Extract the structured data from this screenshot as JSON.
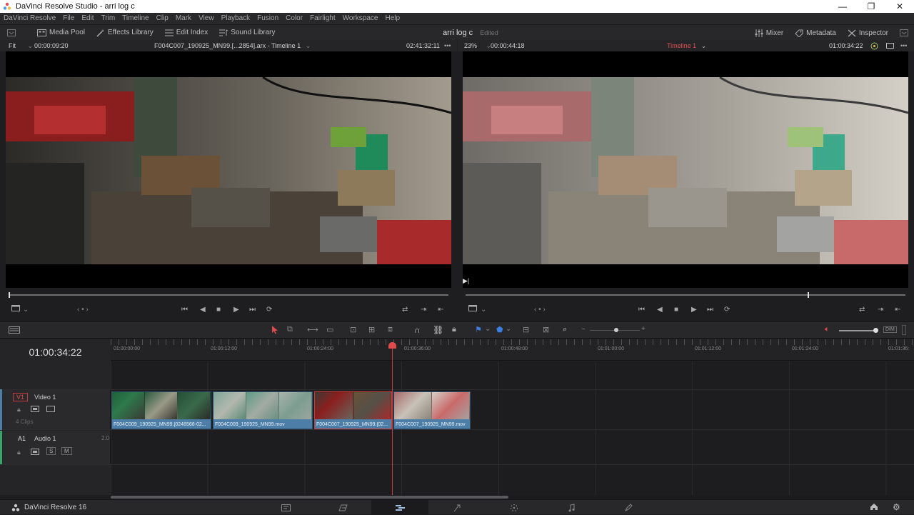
{
  "window": {
    "title": "DaVinci Resolve Studio - arri log c",
    "minimize": "—",
    "maximize": "❐",
    "close": "✕"
  },
  "menu": [
    "DaVinci Resolve",
    "File",
    "Edit",
    "Trim",
    "Timeline",
    "Clip",
    "Mark",
    "View",
    "Playback",
    "Fusion",
    "Color",
    "Fairlight",
    "Workspace",
    "Help"
  ],
  "toolbar": {
    "media_pool": "Media Pool",
    "effects_library": "Effects Library",
    "edit_index": "Edit Index",
    "sound_library": "Sound Library",
    "project_name": "arri log c",
    "project_status": "Edited",
    "mixer": "Mixer",
    "metadata": "Metadata",
    "inspector": "Inspector"
  },
  "source_viewer": {
    "zoom": "Fit",
    "duration": "00:00:09:20",
    "clip_name": "F004C007_190925_MN99.[...2854].arx - Timeline 1",
    "timecode": "02:41:32:11"
  },
  "timeline_viewer": {
    "zoom": "23%",
    "duration": "00:00:44:18",
    "timeline_name": "Timeline 1",
    "timecode": "01:00:34:22"
  },
  "timeline": {
    "current_timecode": "01:00:34:22",
    "ruler_ticks": [
      "01:00:00:00",
      "01:00:12:00",
      "01:00:24:00",
      "01:00:36:00",
      "01:00:48:00",
      "01:01:00:00",
      "01:01:12:00",
      "01:01:24:00",
      "01:01:36:"
    ],
    "video_track": {
      "id": "V1",
      "name": "Video 1",
      "clip_count": "4 Clips"
    },
    "audio_track": {
      "id": "A1",
      "name": "Audio 1",
      "channels": "2.0",
      "solo": "S",
      "mute": "M"
    },
    "clips": [
      {
        "label": "F004C009_190925_MN99.[0248568-02..."
      },
      {
        "label": "F004C009_190925_MN99.mov"
      },
      {
        "label": "F004C007_190925_MN99.[02..."
      },
      {
        "label": "F004C007_190925_MN99.mov"
      }
    ]
  },
  "bottom_bar": {
    "brand": "DaVinci Resolve 16"
  },
  "colors": {
    "accent_red": "#d23c3c",
    "clip_blue": "#4d7ea8",
    "background": "#1e1e21"
  }
}
